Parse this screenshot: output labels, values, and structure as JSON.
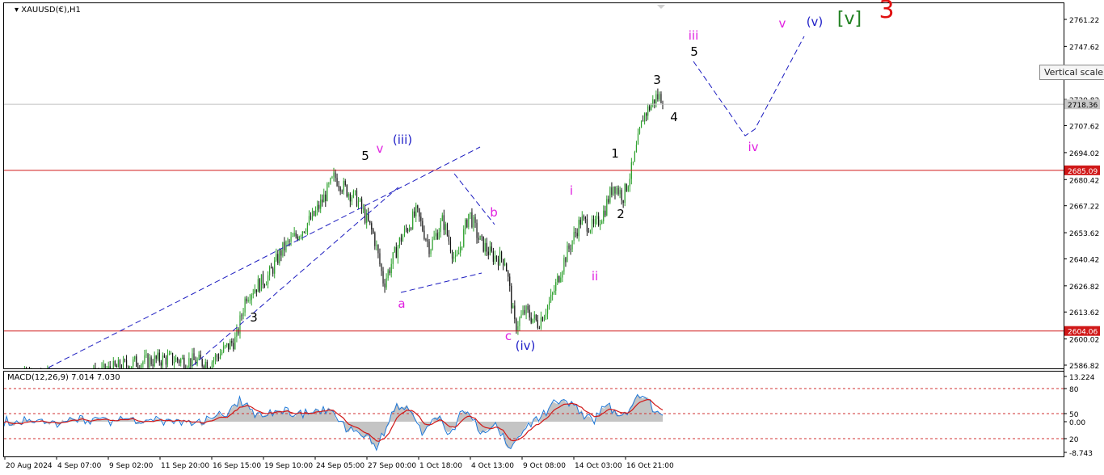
{
  "chart_data": {
    "type": "candlestick",
    "symbol_label": "XAUUSD(€),H1",
    "price_axis_ticks": [
      "2761.22",
      "2747.62",
      "2720.82",
      "2707.62",
      "2694.02",
      "2680.42",
      "2667.22",
      "2653.62",
      "2640.42",
      "2626.82",
      "2613.62",
      "2600.02",
      "2586.82"
    ],
    "tick_values": [
      2761.22,
      2747.62,
      2720.82,
      2707.62,
      2694.02,
      2680.42,
      2667.22,
      2653.62,
      2640.42,
      2626.82,
      2613.62,
      2600.02,
      2586.82
    ],
    "ylim": [
      2584,
      2768
    ],
    "current_price": {
      "value": 2718.36,
      "label": "2718.36"
    },
    "horizontal_levels": [
      {
        "value": 2685.09,
        "label": "2685.09",
        "color": "#d01818"
      },
      {
        "value": 2604.06,
        "label": "2604.06",
        "color": "#d01818"
      }
    ],
    "time_labels": [
      "20 Aug 2024",
      "4 Sep 07:00",
      "9 Sep 02:00",
      "11 Sep 20:00",
      "16 Sep 15:00",
      "19 Sep 10:00",
      "24 Sep 05:00",
      "27 Sep 00:00",
      "1 Oct 18:00",
      "4 Oct 13:00",
      "9 Oct 08:00",
      "14 Oct 03:00",
      "16 Oct 21:00"
    ],
    "price_path": [
      [
        0,
        2582
      ],
      [
        0.1,
        2579
      ],
      [
        0.195,
        2588
      ],
      [
        0.245,
        2590
      ],
      [
        0.31,
        2588
      ],
      [
        0.35,
        2600
      ],
      [
        0.365,
        2622
      ],
      [
        0.4,
        2632
      ],
      [
        0.42,
        2645
      ],
      [
        0.45,
        2655
      ],
      [
        0.468,
        2662
      ],
      [
        0.485,
        2672
      ],
      [
        0.5,
        2682
      ],
      [
        0.515,
        2676
      ],
      [
        0.535,
        2670
      ],
      [
        0.56,
        2652
      ],
      [
        0.575,
        2628
      ],
      [
        0.6,
        2650
      ],
      [
        0.625,
        2664
      ],
      [
        0.645,
        2646
      ],
      [
        0.665,
        2660
      ],
      [
        0.685,
        2638
      ],
      [
        0.705,
        2664
      ],
      [
        0.72,
        2650
      ],
      [
        0.74,
        2642
      ],
      [
        0.76,
        2640
      ],
      [
        0.775,
        2606
      ],
      [
        0.79,
        2614
      ],
      [
        0.81,
        2608
      ],
      [
        0.83,
        2620
      ],
      [
        0.85,
        2640
      ],
      [
        0.875,
        2660
      ],
      [
        0.895,
        2656
      ],
      [
        0.91,
        2664
      ],
      [
        0.925,
        2678
      ],
      [
        0.94,
        2672
      ],
      [
        0.955,
        2688
      ],
      [
        0.97,
        2712
      ],
      [
        0.99,
        2722
      ]
    ],
    "wave_labels": [
      {
        "text": "3",
        "color": "#000000",
        "x": 314,
        "y": 398
      },
      {
        "text": "5",
        "color": "#000000",
        "x": 452,
        "y": 198
      },
      {
        "text": "v",
        "color": "#e020e0",
        "x": 470,
        "y": 189
      },
      {
        "text": "(iii)",
        "color": "#2020c8",
        "x": 498,
        "y": 178
      },
      {
        "text": "a",
        "color": "#e020e0",
        "x": 497,
        "y": 381
      },
      {
        "text": "b",
        "color": "#e020e0",
        "x": 611,
        "y": 268
      },
      {
        "text": "c",
        "color": "#e020e0",
        "x": 629,
        "y": 421
      },
      {
        "text": "(iv)",
        "color": "#2020c8",
        "x": 650,
        "y": 433
      },
      {
        "text": "i",
        "color": "#e020e0",
        "x": 707,
        "y": 241
      },
      {
        "text": "ii",
        "color": "#e020e0",
        "x": 736,
        "y": 347
      },
      {
        "text": "1",
        "color": "#000000",
        "x": 761,
        "y": 195
      },
      {
        "text": "2",
        "color": "#000000",
        "x": 768,
        "y": 270
      },
      {
        "text": "3",
        "color": "#000000",
        "x": 813,
        "y": 104
      },
      {
        "text": "4",
        "color": "#000000",
        "x": 834,
        "y": 150
      },
      {
        "text": "iii",
        "color": "#e020e0",
        "x": 858,
        "y": 49
      },
      {
        "text": "5",
        "color": "#000000",
        "x": 859,
        "y": 69
      },
      {
        "text": "iv",
        "color": "#e020e0",
        "x": 932,
        "y": 187
      },
      {
        "text": "v",
        "color": "#e020e0",
        "x": 968,
        "y": 34
      },
      {
        "text": "(v)",
        "color": "#2020c8",
        "x": 1008,
        "y": 32
      },
      {
        "text": "[v]",
        "color": "#208020",
        "x": 1051,
        "y": 30
      },
      {
        "text": "3",
        "color": "#e01010",
        "x": 1097,
        "y": 22
      }
    ],
    "macd": {
      "label": "MACD(12,26,9) 7.014 7.030",
      "axis_ticks": [
        "13.224",
        "80",
        "50",
        "0.00",
        "20",
        "-8.743"
      ],
      "level_lines": [
        80,
        50,
        20
      ]
    }
  },
  "tooltip": {
    "text": "Vertical scale"
  }
}
